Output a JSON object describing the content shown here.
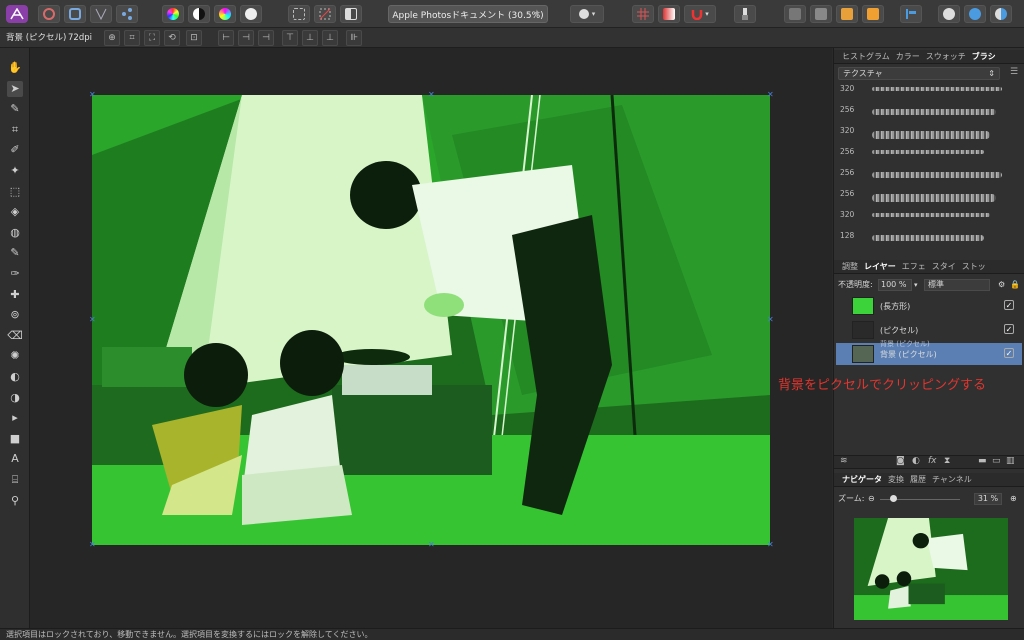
{
  "toolbar": {
    "document_title": "Apple Photosドキュメント (30.5%)",
    "star": "★",
    "colors": {
      "accent": "#4a7fd6",
      "photo_green": "#3cb93a"
    }
  },
  "context_bar": {
    "layer_label": "背景 (ピクセル)",
    "dpi": "72dpi"
  },
  "tools": [
    {
      "name": "hand-icon",
      "glyph": "✋"
    },
    {
      "name": "move-icon",
      "glyph": "➤"
    },
    {
      "name": "eyedropper-icon",
      "glyph": "✎"
    },
    {
      "name": "crop-icon",
      "glyph": "⌗"
    },
    {
      "name": "brush-icon",
      "glyph": "✐"
    },
    {
      "name": "magic-brush-icon",
      "glyph": "✦"
    },
    {
      "name": "marquee-icon",
      "glyph": "⬚"
    },
    {
      "name": "flood-fill-icon",
      "glyph": "◈"
    },
    {
      "name": "color-wheel-icon",
      "glyph": "◍"
    },
    {
      "name": "paint-brush-icon",
      "glyph": "✎"
    },
    {
      "name": "pixel-brush-icon",
      "glyph": "✑"
    },
    {
      "name": "healing-icon",
      "glyph": "✚"
    },
    {
      "name": "clone-icon",
      "glyph": "⊚"
    },
    {
      "name": "erase-icon",
      "glyph": "⌫"
    },
    {
      "name": "smudge-icon",
      "glyph": "✺"
    },
    {
      "name": "dodge-icon",
      "glyph": "◐"
    },
    {
      "name": "burn-icon",
      "glyph": "◑"
    },
    {
      "name": "pen-icon",
      "glyph": "▸"
    },
    {
      "name": "shape-icon",
      "glyph": "■"
    },
    {
      "name": "text-icon",
      "glyph": "A"
    },
    {
      "name": "mesh-icon",
      "glyph": "⌸"
    },
    {
      "name": "zoom-icon",
      "glyph": "⚲"
    }
  ],
  "right_panel": {
    "top_tabs": [
      "ヒストグラム",
      "カラー",
      "スウォッチ",
      "ブラシ"
    ],
    "active_top_tab": "ブラシ",
    "brush_category": "テクスチャ",
    "brush_sizes": [
      "320",
      "256",
      "320",
      "256",
      "256",
      "256",
      "320",
      "128"
    ],
    "layer_tabs": [
      "調整",
      "レイヤー",
      "エフェ",
      "スタイ",
      "ストッ"
    ],
    "active_layer_tab": "レイヤー",
    "opacity_label": "不透明度:",
    "opacity_value": "100 %",
    "blend_mode": "標準",
    "layers": [
      {
        "name": "(長方形)",
        "checked": "✓"
      },
      {
        "name": "(ピクセル)",
        "checked": "✓"
      },
      {
        "name": "背景 (ピクセル)",
        "ghost": "背景 (ピクセル)",
        "checked": "✓"
      }
    ],
    "nav_tabs": [
      "ナビゲータ",
      "変換",
      "履歴",
      "チャンネル"
    ],
    "active_nav_tab": "ナビゲータ",
    "zoom_label": "ズーム:",
    "zoom_value": "31 %"
  },
  "annotation": "背景をピクセルでクリッピングする",
  "status": "選択項目はロックされており、移動できません。選択項目を変換するにはロックを解除してください。"
}
